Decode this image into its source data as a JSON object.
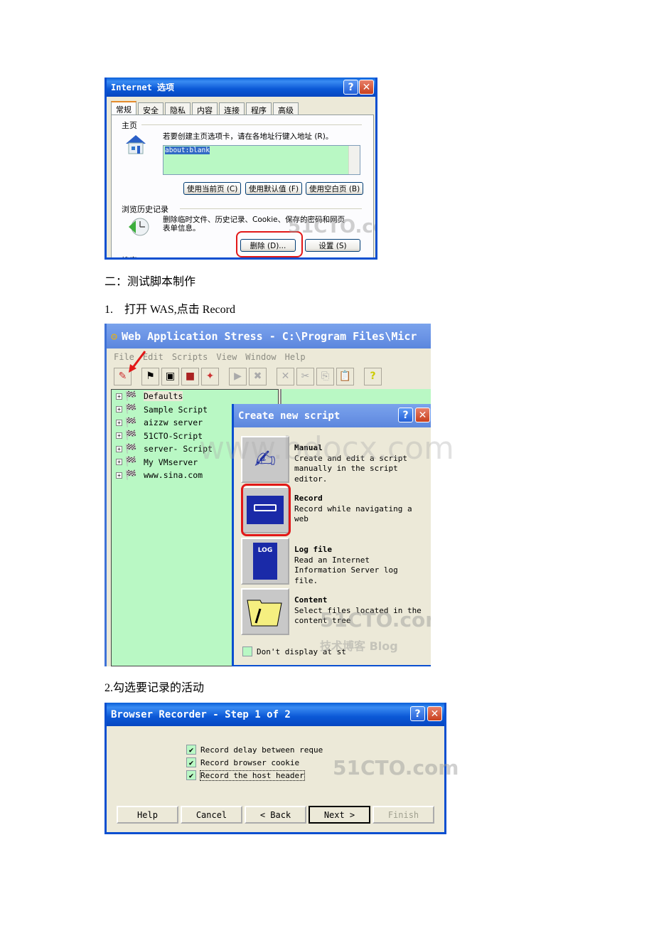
{
  "internet_options": {
    "title": "Internet 选项",
    "tabs": [
      "常规",
      "安全",
      "隐私",
      "内容",
      "连接",
      "程序",
      "高级"
    ],
    "home_group_label": "主页",
    "home_instruction": "若要创建主页选项卡，请在各地址行键入地址 (R)。",
    "home_address": "about:blank",
    "home_buttons": [
      "使用当前页 (C)",
      "使用默认值 (F)",
      "使用空白页 (B)"
    ],
    "history_group_label": "浏览历史记录",
    "history_description_1": "删除临时文件、历史记录、Cookie、保存的密码和网页",
    "history_description_2": "表单信息。",
    "delete_button": "删除 (D)...",
    "settings_button": "设置 (S)",
    "search_group_label": "搜索",
    "help_glyph": "?",
    "close_glyph": "✕"
  },
  "doc": {
    "section_heading": "二：测试脚本制作",
    "step1": "1.　打开 WAS,点击 Record",
    "step2": "2.勾选要记录的活动"
  },
  "was": {
    "title": "Web Application Stress - C:\\Program Files\\Micr",
    "menu": [
      "File",
      "Edit",
      "Scripts",
      "View",
      "Window",
      "Help"
    ],
    "tree_items": [
      "Defaults",
      "Sample Script",
      "aizzw server",
      "51CTO-Script",
      "server- Script",
      "My VMserver",
      "www.sina.com"
    ],
    "create_dialog": {
      "title": "Create new script",
      "options": [
        {
          "title": "Manual",
          "desc": "Create and edit a script manually in the script editor."
        },
        {
          "title": "Record",
          "desc": "Record while navigating a web"
        },
        {
          "title": "Log file",
          "desc": "Read an Internet Information Server log file."
        },
        {
          "title": "Content",
          "desc": "Select files located in the content tree"
        }
      ],
      "dont_display": "Don't display at st"
    }
  },
  "recorder": {
    "title": "Browser Recorder - Step 1 of 2",
    "checks": [
      {
        "label": "Record delay between reque",
        "checked": true
      },
      {
        "label": "Record browser cookie",
        "checked": true
      },
      {
        "label": "Record the host header",
        "checked": true
      }
    ],
    "buttons": [
      "Help",
      "Cancel",
      "< Back",
      "Next >",
      "Finish"
    ]
  },
  "watermarks": {
    "site": "51CTO.com",
    "blog": "技术博客 Blog",
    "bdocx": "www.bdocx.com"
  }
}
